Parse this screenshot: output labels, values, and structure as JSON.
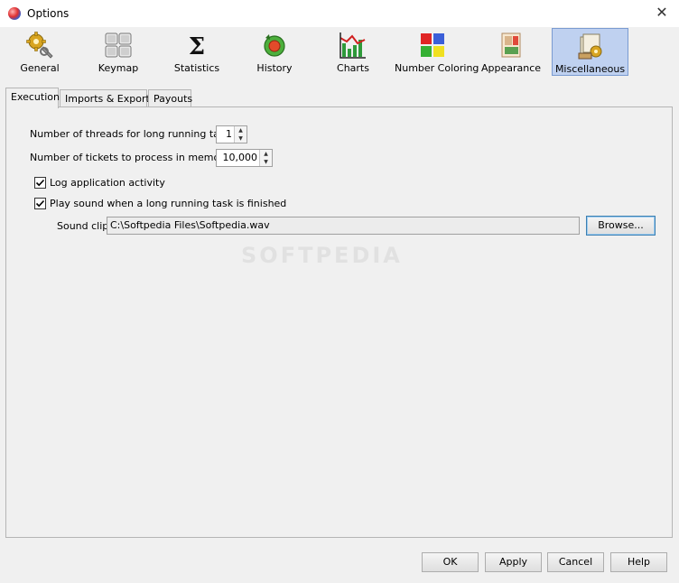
{
  "window": {
    "title": "Options",
    "close_glyph": "✕"
  },
  "toolbar": {
    "items": [
      {
        "label": "General",
        "icon": "gears-icon"
      },
      {
        "label": "Keymap",
        "icon": "keyboard-icon"
      },
      {
        "label": "Statistics",
        "icon": "sigma-icon",
        "glyph": "Σ"
      },
      {
        "label": "History",
        "icon": "history-icon"
      },
      {
        "label": "Charts",
        "icon": "bar-chart-icon"
      },
      {
        "label": "Number Coloring",
        "icon": "color-squares-icon"
      },
      {
        "label": "Appearance",
        "icon": "appearance-icon"
      },
      {
        "label": "Miscellaneous",
        "icon": "misc-box-icon",
        "selected": true
      }
    ]
  },
  "tabs": [
    {
      "label": "Execution",
      "active": true
    },
    {
      "label": "Imports & Exports"
    },
    {
      "label": "Payouts"
    }
  ],
  "execution": {
    "threads_label": "Number of threads for long running tasks:",
    "threads_value": "1",
    "tickets_label": "Number of tickets to process in memory:",
    "tickets_value": "10,000",
    "log_label": "Log application activity",
    "log_checked": true,
    "sound_label": "Play sound when a long running task is finished",
    "sound_checked": true,
    "sound_clip_label": "Sound clip:",
    "sound_clip_value": "C:\\Softpedia Files\\Softpedia.wav",
    "browse_label": "Browse..."
  },
  "footer": {
    "ok": "OK",
    "apply": "Apply",
    "cancel": "Cancel",
    "help": "Help"
  },
  "watermark": "SOFTPEDIA",
  "colors": {
    "selected_bg": "#bfd1f0",
    "selected_border": "#7a9bd1",
    "focus": "#3c7fb1"
  }
}
